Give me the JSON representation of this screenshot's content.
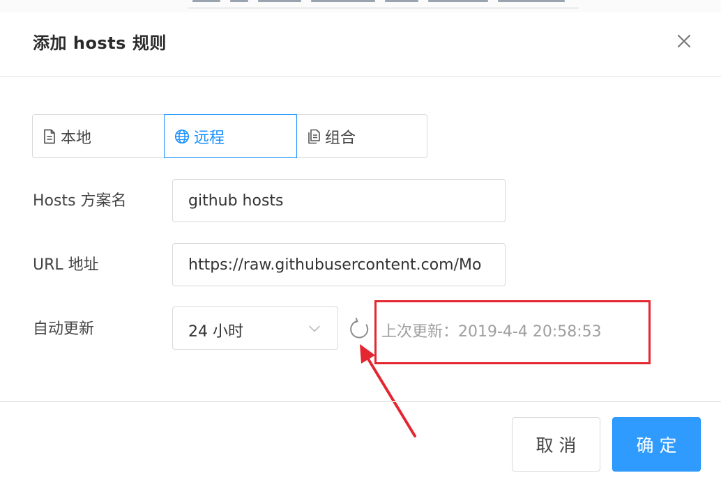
{
  "dialog": {
    "title": "添加 hosts 规则"
  },
  "source_types": [
    {
      "label": "本地",
      "icon": "file-icon",
      "selected": false
    },
    {
      "label": "远程",
      "icon": "globe-icon",
      "selected": true
    },
    {
      "label": "组合",
      "icon": "files-icon",
      "selected": false
    }
  ],
  "form": {
    "name_label": "Hosts 方案名",
    "name_value": "github hosts",
    "url_label": "URL 地址",
    "url_value": "https://raw.githubusercontent.com/Mo",
    "auto_update_label": "自动更新",
    "auto_update_value": "24 小时",
    "last_updated": "上次更新：2019-4-4 20:58:53"
  },
  "footer": {
    "cancel_label": "取消",
    "ok_label": "确定"
  },
  "colors": {
    "accent": "#1890ff",
    "annotation": "#e3262f"
  }
}
